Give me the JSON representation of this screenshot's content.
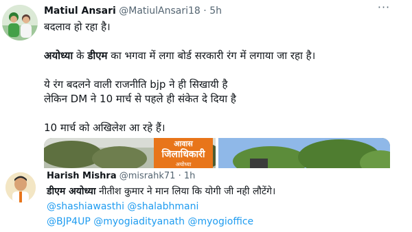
{
  "tweet1": {
    "name": "Matiul Ansari",
    "handle": "@MatiulAnsari18",
    "separator": "·",
    "time": "5h",
    "more": "···",
    "line1": "बदलाव हो रहा है।",
    "line2_bold_a": "अयोध्या",
    "line2_a": " के ",
    "line2_bold_b": "डीएम",
    "line2_b": " का भगवा में लगा बोर्ड सरकारी रंग में लगाया जा रहा है।",
    "line3": "ये रंग बदलने वाली राजनीति bjp ने ही सिखायी है",
    "line4": "लेकिन DM ने 10 मार्च से पहले ही संकेत दे दिया है",
    "line5": "10 मार्च को अखिलेश आ रहे हैं।",
    "media": {
      "sign_line1": "आवास",
      "sign_line2": "जिलाधिकारी",
      "sign_line3": "अयोध्या"
    }
  },
  "tweet2": {
    "name": "Harish Mishra",
    "handle": "@misrahk71",
    "separator": "·",
    "time": "1h",
    "line1_bold": "डीएम अयोध्या",
    "line1_rest": " नीतीश कुमार ने मान लिया कि योगी जी नही लौटेंगे।",
    "mentions1": [
      "@shashiawasthi",
      "@shalabhmani"
    ],
    "mentions2": [
      "@BJP4UP",
      "@myogiadityanath",
      "@myogioffice"
    ]
  },
  "colors": {
    "text": "#0f1419",
    "secondary": "#536471",
    "link": "#1d9bf0",
    "sign_orange": "#e8751a"
  }
}
